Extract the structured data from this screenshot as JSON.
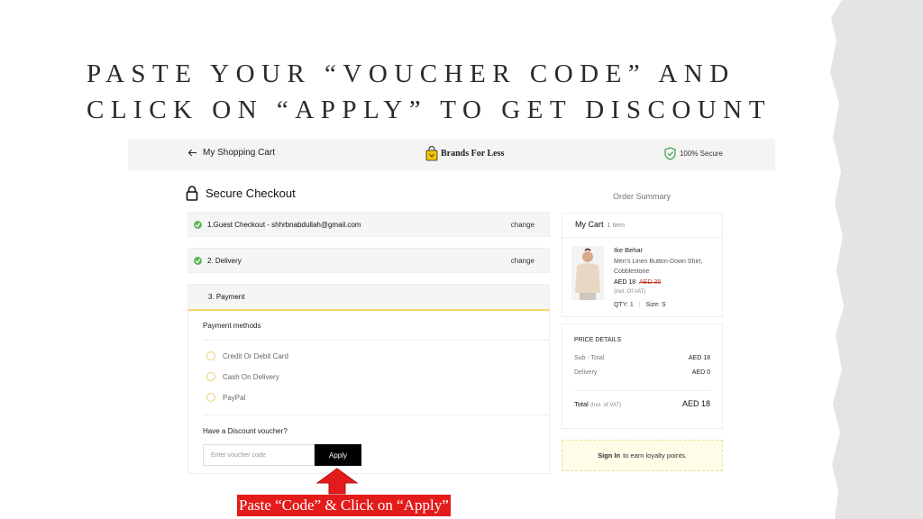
{
  "slide": {
    "title_line1": "PASTE YOUR “VOUCHER CODE” AND",
    "title_line2": "CLICK ON “APPLY” TO GET DISCOUNT",
    "callout": "Paste “Code” & Click on “Apply”"
  },
  "header": {
    "back_label": "My Shopping Cart",
    "brand": "Brands For Less",
    "secure_label": "100% Secure"
  },
  "checkout": {
    "title": "Secure Checkout",
    "steps": [
      {
        "label": "1.Guest Checkout -  shhrbnabdullah@gmail.com",
        "action": "change"
      },
      {
        "label": "2. Delivery",
        "action": "change"
      },
      {
        "label": "3. Payment"
      }
    ],
    "payment_methods_title": "Payment methods",
    "methods": [
      "Credit Or Debit Card",
      "Cash On Delivery",
      "PayPal"
    ],
    "voucher_question": "Have a Discount voucher?",
    "voucher_placeholder": "Enter voucher code",
    "apply_label": "Apply"
  },
  "summary": {
    "heading": "Order Summary",
    "cart_title": "My Cart",
    "cart_count": "1 Item",
    "product": {
      "brand": "Ike Behar",
      "name": "Men's Linen Button-Down Shirt, Cobblestone",
      "price": "AED 18",
      "old_price": "AED 35",
      "vat_note": "(Incl. Of VAT)",
      "qty": "QTY: 1",
      "size": "Size: S"
    },
    "price_details_title": "PRICE DETAILS",
    "subtotal_label": "Sub - Total",
    "subtotal_value": "AED 18",
    "delivery_label": "Delivery",
    "delivery_value": "AED 0",
    "total_label": "Total",
    "total_note": "(Incl. of VAT)",
    "total_value": "AED 18",
    "loyalty_link": "Sign In",
    "loyalty_text": "to earn loyalty points."
  },
  "colors": {
    "callout_bg": "#e41b1b",
    "check_green": "#5cb85c",
    "accent_yellow": "#f5d66a",
    "apply_bg": "#000000"
  }
}
